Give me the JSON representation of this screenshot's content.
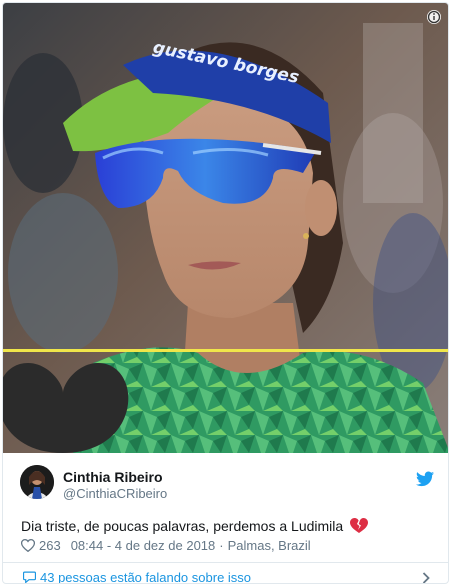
{
  "tweet": {
    "author_name": "Cinthia Ribeiro",
    "author_handle": "@CinthiaCRibeiro",
    "text": "Dia triste, de poucas palavras, perdemos a Ludimila",
    "likes": "263",
    "time": "08:44 - 4 de dez de 2018",
    "location": "Palmas, Brazil",
    "separator": "·",
    "footer_label": "43 pessoas estão falando sobre isso"
  },
  "media": {
    "visor_text": "gustavo borges",
    "description_icon": "info-icon"
  },
  "icons": {
    "twitter": "twitter-bird-icon",
    "like": "heart-outline-icon",
    "broken_heart": "broken-heart-emoji",
    "conversation": "speech-bubble-icon",
    "chevron": "chevron-right-icon"
  },
  "colors": {
    "twitter_blue": "#1da1f2",
    "link_blue": "#1b95e0",
    "secondary_text": "#657786",
    "broken_heart": "#dd2e44",
    "visor_blue": "#1f3fa8",
    "visor_green": "#7dc142",
    "jersey_green": "#3aa86b",
    "mourning_line": "#f0e64a"
  }
}
